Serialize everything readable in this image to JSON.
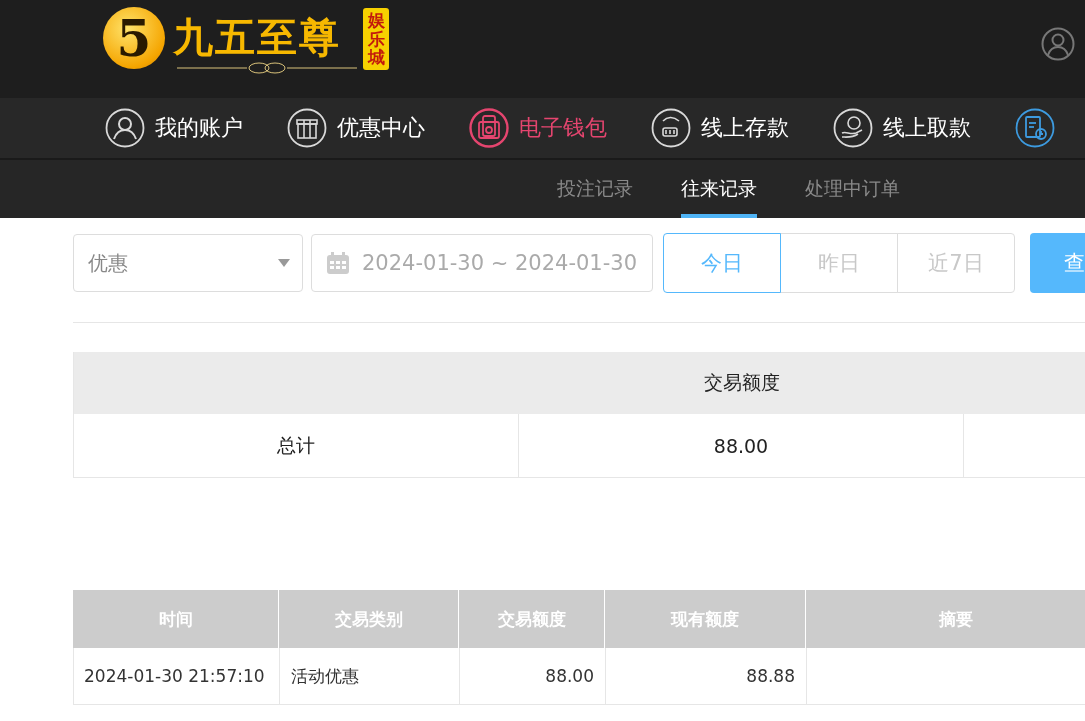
{
  "header": {
    "logo": {
      "mark": "5",
      "name": "九五至尊",
      "badge": "娱乐城"
    }
  },
  "nav": [
    {
      "kind": "user",
      "label": "我的账户",
      "selected": false,
      "color": "#d9d9d9"
    },
    {
      "kind": "gift",
      "label": "优惠中心",
      "selected": false,
      "color": "#d9d9d9"
    },
    {
      "kind": "wallet",
      "label": "电子钱包",
      "selected": true,
      "color": "#e5456f"
    },
    {
      "kind": "deposit",
      "label": "线上存款",
      "selected": false,
      "color": "#d9d9d9"
    },
    {
      "kind": "withdraw",
      "label": "线上取款",
      "selected": false,
      "color": "#d9d9d9"
    },
    {
      "kind": "report",
      "selected": false,
      "color": "#3d9be0"
    }
  ],
  "subtabs": [
    {
      "label": "投注记录",
      "selected": false
    },
    {
      "label": "往来记录",
      "selected": true
    },
    {
      "label": "处理中订单",
      "selected": false
    }
  ],
  "filters": {
    "type_select": {
      "value": "优惠"
    },
    "date_range": {
      "value": "2024-01-30 ~ 2024-01-30"
    },
    "quick_ranges": [
      {
        "label": "今日",
        "selected": true
      },
      {
        "label": "昨日",
        "selected": false
      },
      {
        "label": "近7日",
        "selected": false
      }
    ],
    "search_button": "查"
  },
  "summary": {
    "header": "交易额度",
    "row": [
      "总计",
      "88.00"
    ]
  },
  "detail": {
    "columns": [
      "时间",
      "交易类别",
      "交易额度",
      "现有额度",
      "摘要"
    ],
    "rows": [
      [
        "2024-01-30 21:57:10",
        "活动优惠",
        "88.00",
        "88.88",
        ""
      ]
    ]
  }
}
